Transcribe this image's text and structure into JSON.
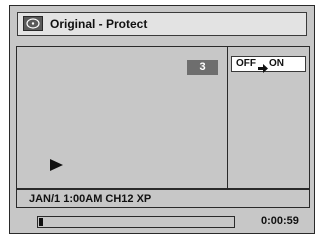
{
  "title": "Original - Protect",
  "chapter_number": "3",
  "playback_icon": "play-icon",
  "setting": {
    "from": "OFF",
    "arrow_icon": "right-arrow-icon",
    "to": "ON"
  },
  "info_line": "JAN/1 1:00AM CH12 XP",
  "progress_fraction": 0.02,
  "elapsed_time": "0:00:59"
}
